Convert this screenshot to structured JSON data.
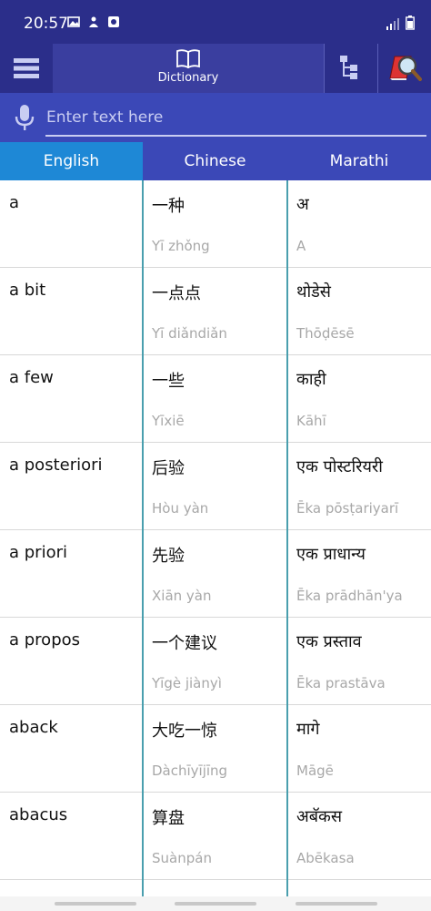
{
  "status": {
    "time": "20:57"
  },
  "toolbar": {
    "title": "Dictionary"
  },
  "search": {
    "placeholder": "Enter text here",
    "value": ""
  },
  "tabs": [
    {
      "label": "English",
      "active": true
    },
    {
      "label": "Chinese",
      "active": false
    },
    {
      "label": "Marathi",
      "active": false
    }
  ],
  "rows": [
    {
      "en": "a",
      "zh": "一种",
      "zh_roman": "Yī zhǒng",
      "mr": "अ",
      "mr_roman": "A"
    },
    {
      "en": "a bit",
      "zh": "一点点",
      "zh_roman": "Yī diǎndiǎn",
      "mr": "थोडेसे",
      "mr_roman": "Thōḍēsē"
    },
    {
      "en": "a few",
      "zh": "一些",
      "zh_roman": "Yīxiē",
      "mr": "काही",
      "mr_roman": "Kāhī"
    },
    {
      "en": "a posteriori",
      "zh": "后验",
      "zh_roman": "Hòu yàn",
      "mr": "एक पोस्टरियरी",
      "mr_roman": "Ēka pōsṭariyarī"
    },
    {
      "en": "a priori",
      "zh": "先验",
      "zh_roman": "Xiān yàn",
      "mr": "एक प्राधान्य",
      "mr_roman": "Ēka prādhān'ya"
    },
    {
      "en": "a propos",
      "zh": "一个建议",
      "zh_roman": "Yīgè jiànyì",
      "mr": "एक प्रस्ताव",
      "mr_roman": "Ēka prastāva"
    },
    {
      "en": "aback",
      "zh": "大吃一惊",
      "zh_roman": "Dàchīyījīng",
      "mr": "मागे",
      "mr_roman": "Māgē"
    },
    {
      "en": "abacus",
      "zh": "算盘",
      "zh_roman": "Suànpán",
      "mr": "अबॅकस",
      "mr_roman": "Abēkasa"
    }
  ],
  "colors": {
    "bar": "#2b2e8a",
    "search_bg": "#3b48b7",
    "active_tab": "#1e88d6",
    "divider": "#4a9fae"
  }
}
